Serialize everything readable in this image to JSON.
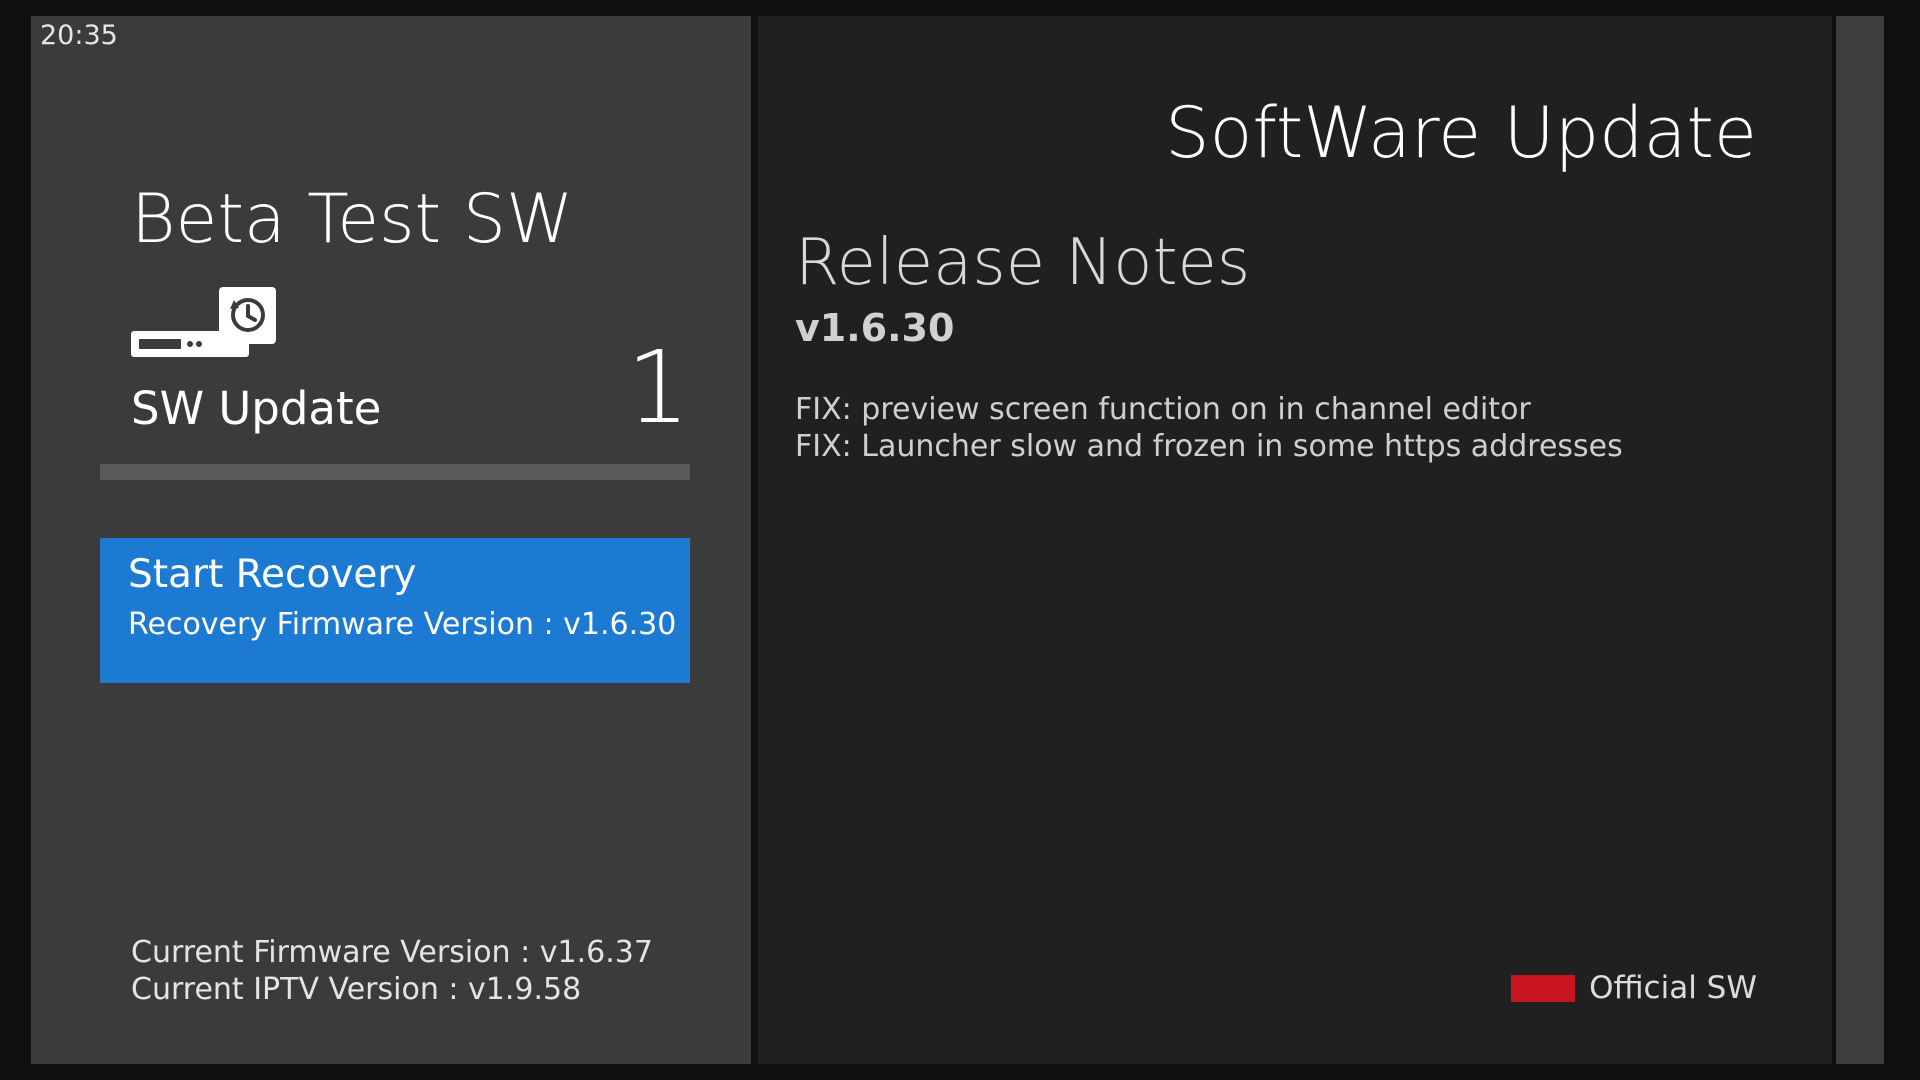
{
  "status_bar": {
    "clock": "20:35"
  },
  "left_panel": {
    "title": "Beta Test SW",
    "device_icon": "set-top-box-history-icon",
    "device_label": "SW Update",
    "update_count": "1",
    "recovery_button": {
      "title": "Start Recovery",
      "subtitle": "Recovery Firmware Version : v1.6.30",
      "color": "#1c7ad3"
    },
    "current_firmware": "Current Firmware Version : v1.6.37",
    "current_iptv": "Current IPTV Version : v1.9.58"
  },
  "right_panel": {
    "title": "SoftWare Update",
    "notes_title": "Release Notes",
    "notes_version": "v1.6.30",
    "notes": [
      "FIX: preview screen function on in channel editor",
      "FIX: Launcher slow and frozen in some https addresses"
    ],
    "legend": {
      "label": "Official SW",
      "color": "#c8141e"
    }
  }
}
